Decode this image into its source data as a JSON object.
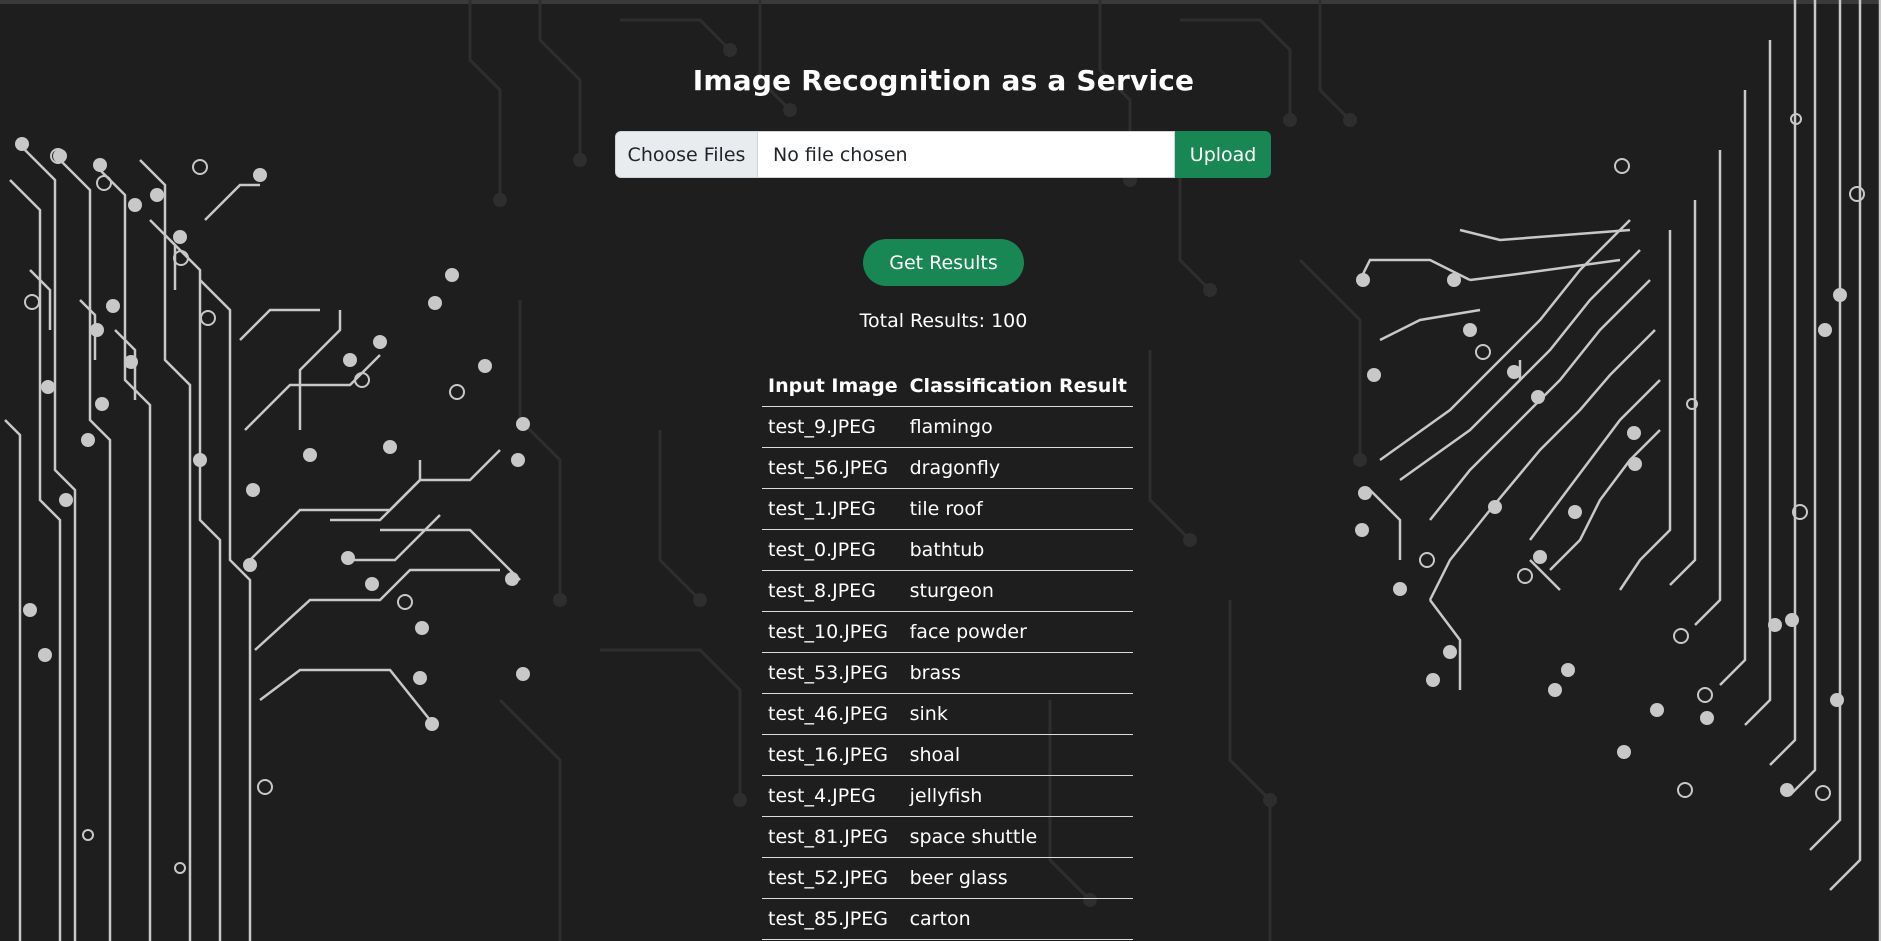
{
  "page": {
    "title": "Image Recognition as a Service"
  },
  "upload": {
    "choose_label": "Choose Files",
    "status": "No file chosen",
    "upload_label": "Upload"
  },
  "results_button": "Get Results",
  "total_results": "Total Results: 100",
  "table": {
    "headers": [
      "Input Image",
      "Classification Result"
    ],
    "rows": [
      [
        "test_9.JPEG",
        "flamingo"
      ],
      [
        "test_56.JPEG",
        "dragonfly"
      ],
      [
        "test_1.JPEG",
        "tile roof"
      ],
      [
        "test_0.JPEG",
        "bathtub"
      ],
      [
        "test_8.JPEG",
        "sturgeon"
      ],
      [
        "test_10.JPEG",
        "face powder"
      ],
      [
        "test_53.JPEG",
        "brass"
      ],
      [
        "test_46.JPEG",
        "sink"
      ],
      [
        "test_16.JPEG",
        "shoal"
      ],
      [
        "test_4.JPEG",
        "jellyfish"
      ],
      [
        "test_81.JPEG",
        "space shuttle"
      ],
      [
        "test_52.JPEG",
        "beer glass"
      ],
      [
        "test_85.JPEG",
        "carton"
      ]
    ]
  },
  "colors": {
    "background": "#1e1e1e",
    "accent": "#198754",
    "circuit": "#c8c8c8"
  }
}
